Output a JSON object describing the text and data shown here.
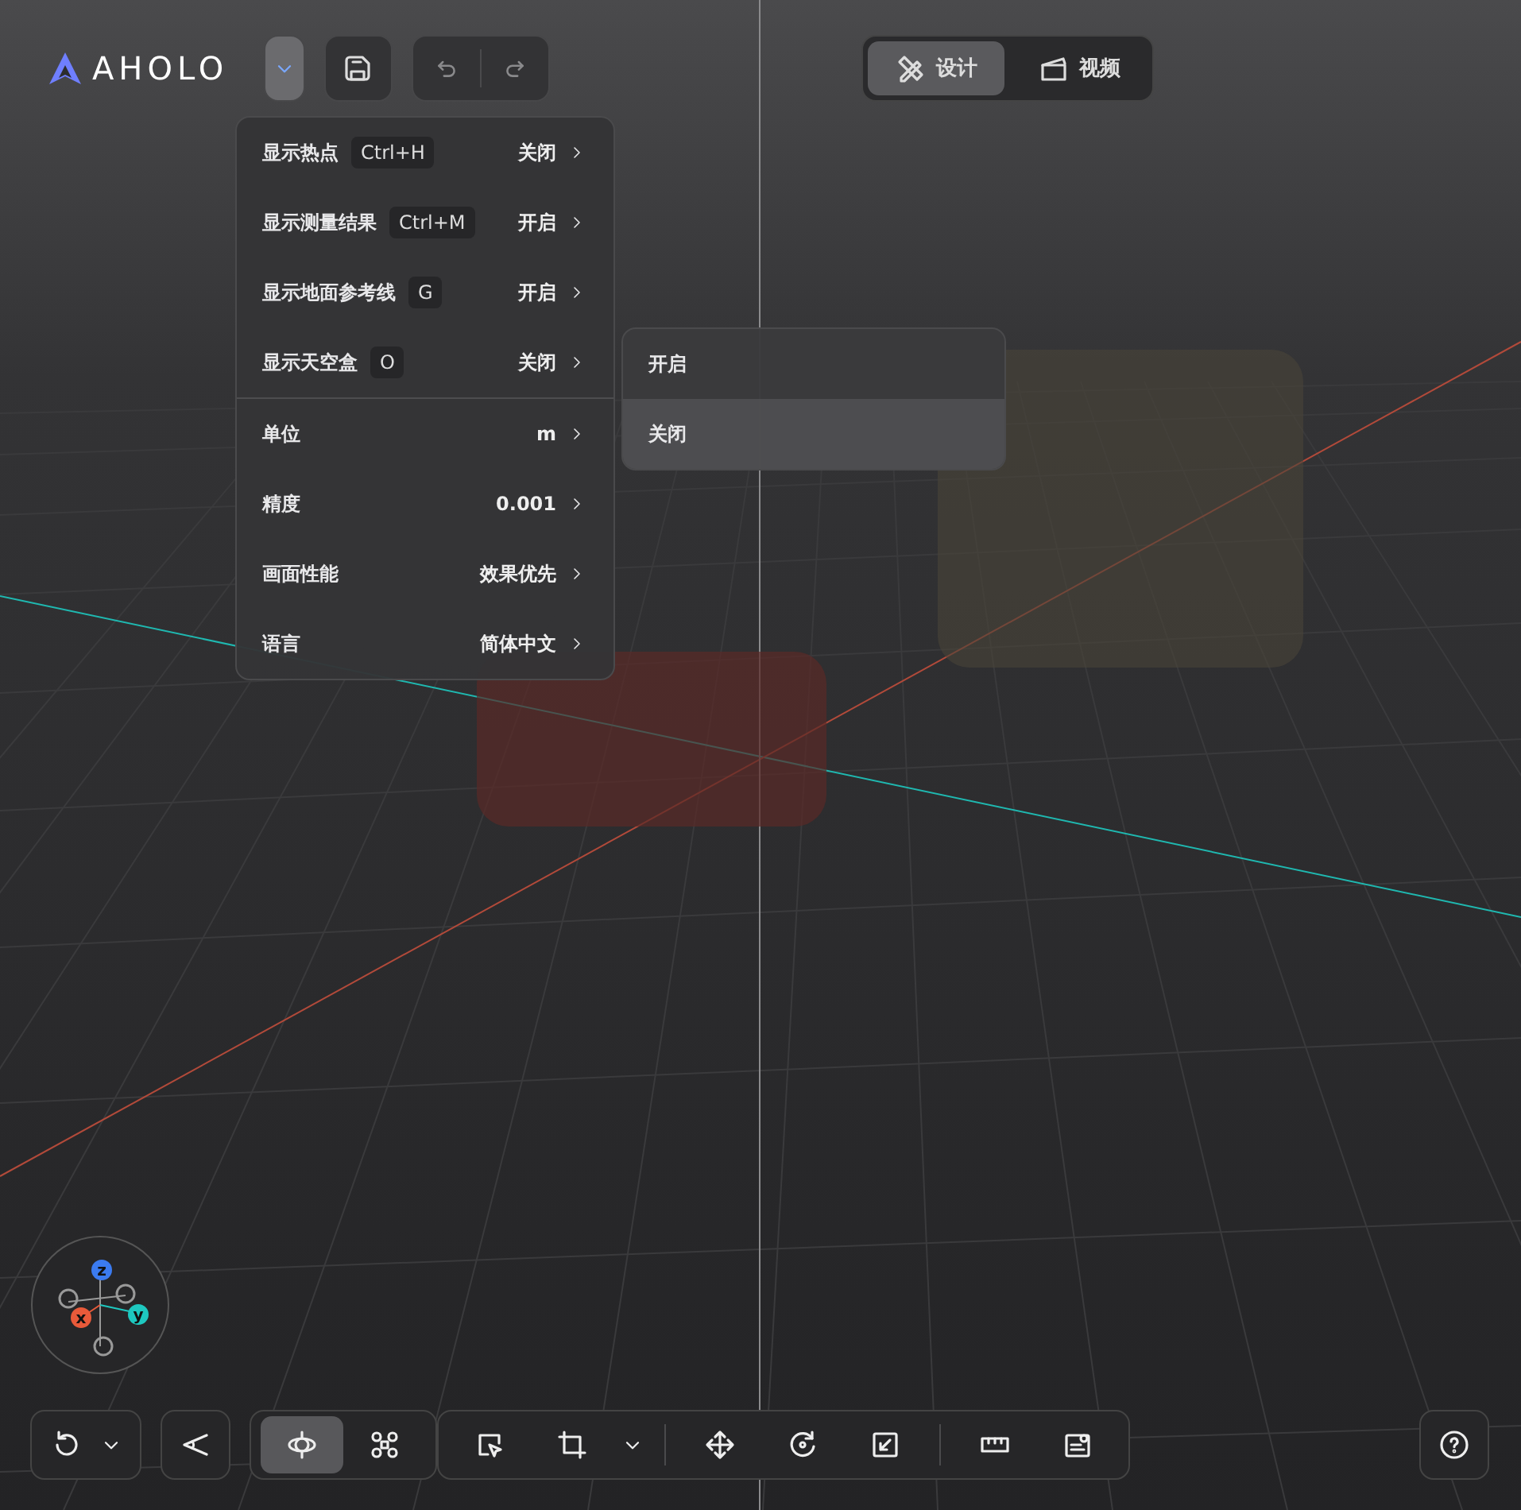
{
  "logo": {
    "text": "AHOLO"
  },
  "mode_tabs": [
    {
      "label": "设计",
      "selected": true
    },
    {
      "label": "视频",
      "selected": false
    }
  ],
  "settings_menu": {
    "items": [
      {
        "kind": "toggle",
        "label": "显示热点",
        "shortcut": "Ctrl+H",
        "value": "关闭"
      },
      {
        "kind": "toggle",
        "label": "显示测量结果",
        "shortcut": "Ctrl+M",
        "value": "开启"
      },
      {
        "kind": "toggle",
        "label": "显示地面参考线",
        "shortcut": "G",
        "value": "开启"
      },
      {
        "kind": "toggle",
        "label": "显示天空盒",
        "shortcut": "O",
        "value": "关闭"
      },
      {
        "kind": "setting",
        "label": "单位",
        "value": "m"
      },
      {
        "kind": "setting",
        "label": "精度",
        "value": "0.001"
      },
      {
        "kind": "setting",
        "label": "画面性能",
        "value": "效果优先"
      },
      {
        "kind": "setting",
        "label": "语言",
        "value": "简体中文"
      }
    ]
  },
  "submenu": {
    "items": [
      {
        "label": "开启",
        "selected": false
      },
      {
        "label": "关闭",
        "selected": true
      }
    ]
  },
  "gizmo": {
    "axes": [
      "z",
      "x",
      "y"
    ]
  },
  "toolbar": {
    "navigation_tools": [
      {
        "selected": true
      },
      {
        "selected": false
      }
    ],
    "edit_tools": [
      {
        "selected": false
      },
      {
        "selected": false
      },
      {
        "selected": false
      },
      {
        "selected": false
      },
      {
        "selected": false
      },
      {
        "selected": false
      },
      {
        "selected": false
      }
    ]
  }
}
